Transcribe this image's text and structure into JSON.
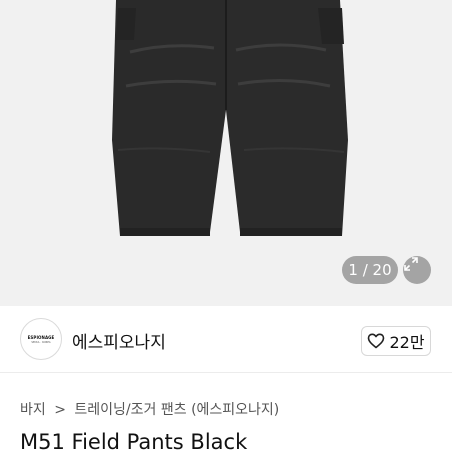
{
  "gallery": {
    "counter_current": "1",
    "counter_sep": "/",
    "counter_total": "20",
    "expand_icon": "expand-arrows-icon",
    "background": "#f1f1f1",
    "product_color": "#2a2a2a"
  },
  "shop": {
    "logo_text_main": "ESPIONAGE",
    "logo_text_sub": "SEOUL · KOREA",
    "name": "에스피오나지",
    "like_icon": "heart-outline-icon",
    "like_count": "22만"
  },
  "breadcrumb": {
    "items": [
      "바지",
      "트레이닝/조거 팬츠 (에스피오나지)"
    ],
    "separator": ">"
  },
  "product": {
    "title": "M51 Field Pants Black"
  }
}
